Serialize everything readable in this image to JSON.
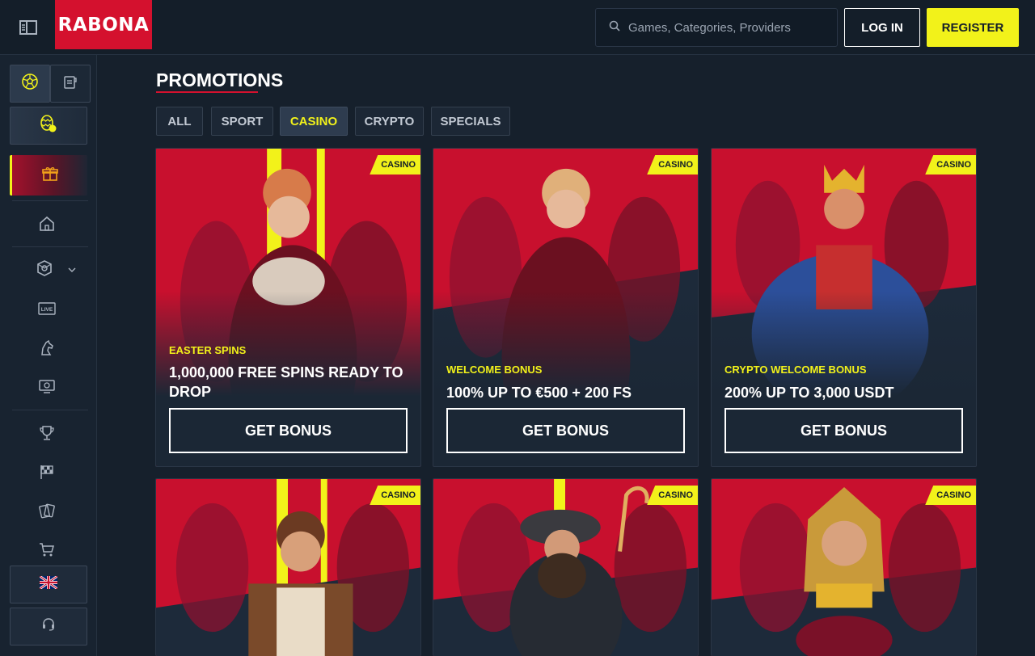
{
  "header": {
    "logo_text": "RABONA",
    "search_placeholder": "Games, Categories, Providers",
    "login_label": "LOG IN",
    "register_label": "REGISTER"
  },
  "sidebar": {
    "icons": [
      "sidebar-toggle-icon",
      "football-icon",
      "betslip-icon",
      "easter-egg-icon",
      "gift-icon",
      "home-icon",
      "casino-chip-icon",
      "live-icon",
      "horse-icon",
      "live-casino-icon",
      "trophy-icon",
      "racing-flag-icon",
      "cards-icon",
      "cart-icon",
      "uk-flag-icon",
      "headset-icon"
    ],
    "live_label": "LIVE"
  },
  "main": {
    "title": "PROMOTIONS",
    "filters": [
      {
        "label": "ALL",
        "active": false
      },
      {
        "label": "SPORT",
        "active": false
      },
      {
        "label": "CASINO",
        "active": true
      },
      {
        "label": "CRYPTO",
        "active": false
      },
      {
        "label": "SPECIALS",
        "active": false
      }
    ],
    "cards": [
      {
        "badge": "CASINO",
        "kicker": "EASTER SPINS",
        "title": "1,000,000 FREE SPINS READY TO DROP",
        "button": "GET BONUS"
      },
      {
        "badge": "CASINO",
        "kicker": "WELCOME BONUS",
        "title": "100% UP TO €500 + 200 FS",
        "button": "GET BONUS"
      },
      {
        "badge": "CASINO",
        "kicker": "CRYPTO WELCOME BONUS",
        "title": "200% UP TO 3,000 USDT",
        "button": "GET BONUS"
      },
      {
        "badge": "CASINO"
      },
      {
        "badge": "CASINO"
      },
      {
        "badge": "CASINO"
      }
    ]
  },
  "colors": {
    "brand_red": "#d4112e",
    "accent_yellow": "#f2f21a",
    "background": "#16202c"
  }
}
